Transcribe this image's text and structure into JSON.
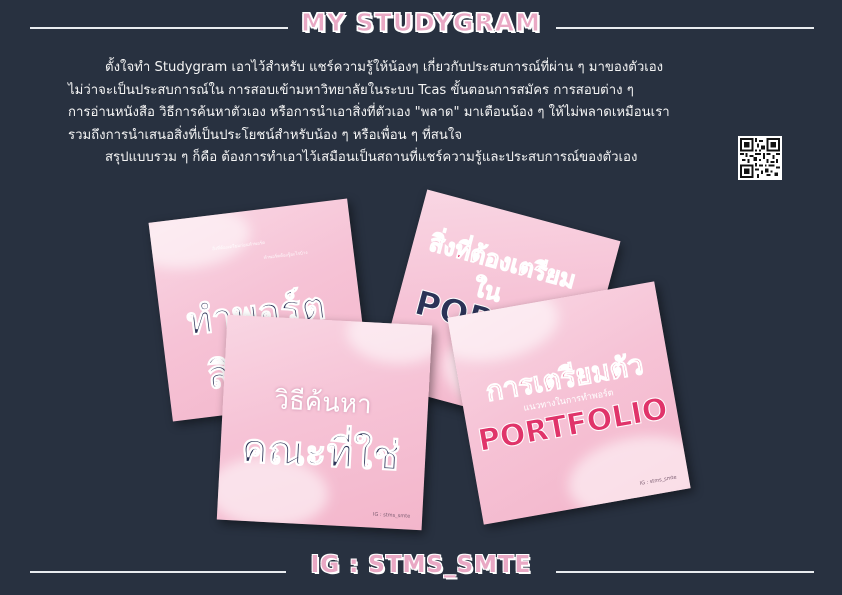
{
  "header": {
    "title": "MY STUDYGRAM"
  },
  "intro": {
    "lines": [
      "ตั้งใจทำ Studygram เอาไว้สำหรับ แชร์ความรู้ให้น้องๆ เกี่ยวกับประสบการณ์ที่ผ่าน ๆ มาของตัวเอง",
      "ไม่ว่าจะเป็นประสบการณ์ใน การสอบเข้ามหาวิทยาลัยในระบบ Tcas  ขั้นตอนการสมัคร  การสอบต่าง ๆ",
      "การอ่านหนังสือ วิธีการค้นหาตัวเอง หรือการนำเอาสิ่งที่ตัวเอง \"พลาด\" มาเตือนน้อง ๆ ให้ไม่พลาดเหมือนเรา",
      "รวมถึงการนำเสนอสิ่งที่เป็นประโยชน์สำหรับน้อง ๆ หรือเพื่อน ๆ ที่สนใจ",
      "สรุปแบบรวม ๆ ก็คือ ต้องการทำเอาไว้เสมือนเป็นสถานที่แชร์ความรู้และประสบการณ์ของตัวเอง"
    ]
  },
  "cards": {
    "card1": {
      "title": "ทำพอร์ต",
      "sub": "สิ",
      "small1": "สิ่งที่ต้องเตรียมก่อนทำพอร์ต",
      "small2": "ทำพอร์ตต้องรู้อะไรบ้าง"
    },
    "card2": {
      "title": "สิ่งที่ต้องเตรียม",
      "mid": "ใน",
      "port": "POR"
    },
    "card3": {
      "title": "วิธีค้นหา",
      "big": "คณะที่ใช่",
      "tag": "IG : stms_smte"
    },
    "card4": {
      "title": "การเตรียมตัว",
      "sub": "แนวทางในการทำพอร์ต",
      "port": "PORTFOLIO",
      "tag": "IG : stms_smte"
    }
  },
  "footer": {
    "handle": "IG : STMS_SMTE"
  },
  "colors": {
    "background": "#283140",
    "accent_pink": "#e9a8c4",
    "card_pink": "#f6c3d6",
    "navy_text": "#2c3357",
    "hot_pink": "#e0346a"
  },
  "icons": {
    "qr": "qr-code-icon"
  }
}
